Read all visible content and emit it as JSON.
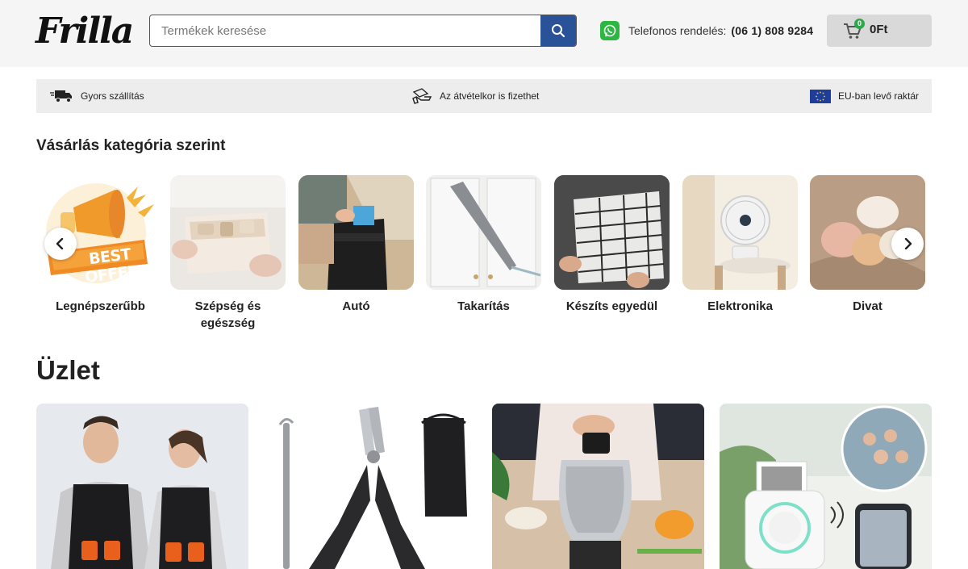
{
  "header": {
    "logo_text": "Frilla",
    "search": {
      "placeholder": "Termékek keresése",
      "value": ""
    },
    "phone": {
      "label": "Telefonos rendelés:",
      "number": "(06 1) 808 9284"
    },
    "cart": {
      "count": "0",
      "total": "0Ft"
    }
  },
  "usp": [
    {
      "label": "Gyors szállítás",
      "icon": "delivery-truck-icon"
    },
    {
      "label": "Az átvételkor is fizethet",
      "icon": "hand-payment-icon"
    },
    {
      "label": "EU-ban levő raktár",
      "icon": "eu-flag-icon"
    }
  ],
  "categories": {
    "title": "Vásárlás kategória szerint",
    "items": [
      {
        "label": "Legnépszerűbb",
        "badge": "BEST OFFER"
      },
      {
        "label": "Szépség és egészség"
      },
      {
        "label": "Autó"
      },
      {
        "label": "Takarítás"
      },
      {
        "label": "Készíts egyedül"
      },
      {
        "label": "Elektronika"
      },
      {
        "label": "Divat"
      }
    ]
  },
  "shop": {
    "title": "Üzlet"
  },
  "colors": {
    "accent": "#2a5298",
    "whatsapp": "#2bb741",
    "badge": "#2aa84a"
  }
}
